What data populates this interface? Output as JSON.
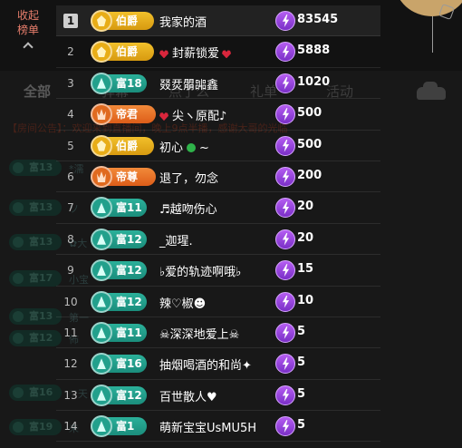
{
  "header": {
    "collapse_label_line1": "收起",
    "collapse_label_line2": "榜单"
  },
  "background": {
    "tabs": [
      "全部",
      "弹幕",
      "点了么",
      "礼单",
      "活动"
    ],
    "notice": "【房间公告】：欢迎来到直播间，晚上9点半播，感谢大哥的光临",
    "chat_badges": [
      "富13",
      "富13",
      "富13",
      "富17",
      "富13",
      "富12",
      "富16",
      "富19"
    ],
    "chat_snippets": [
      "*濡",
      "ソ",
      "✿大",
      "小宝",
      "第一",
      "佈",
      "♡天",
      "未"
    ]
  },
  "colors": {
    "gold_badge": "#f2c02b",
    "orange_badge": "#f28a3a",
    "teal_badge": "#2bb09a",
    "lightning": "#8a3ad6",
    "collapse_text": "#e87e6c"
  },
  "ranking": [
    {
      "rank": "1",
      "badge_type": "gold",
      "badge": "伯爵",
      "name": "我家的酒",
      "score": "83545"
    },
    {
      "rank": "2",
      "badge_type": "gold",
      "badge": "伯爵",
      "name": "封薪锁爱",
      "score": "5888",
      "hearts": true
    },
    {
      "rank": "3",
      "badge_type": "teal",
      "badge": "富18",
      "name": "叕烎朤嘂鑫",
      "score": "1020"
    },
    {
      "rank": "4",
      "badge_type": "orange",
      "badge": "帝君",
      "name": "尖ヽ原配♪",
      "score": "500",
      "heart_left": true
    },
    {
      "rank": "5",
      "badge_type": "gold",
      "badge": "伯爵",
      "name": "初心",
      "score": "500",
      "clover": true,
      "suffix": "~"
    },
    {
      "rank": "6",
      "badge_type": "orange",
      "badge": "帝尊",
      "name": "退了，勿念",
      "score": "200"
    },
    {
      "rank": "7",
      "badge_type": "teal",
      "badge": "富11",
      "name": "♬越吻伤心",
      "score": "20"
    },
    {
      "rank": "8",
      "badge_type": "teal",
      "badge": "富12",
      "name": "_迦瑆.",
      "score": "20"
    },
    {
      "rank": "9",
      "badge_type": "teal",
      "badge": "富12",
      "name": "♭爱的轨迹啊哦♭",
      "score": "15"
    },
    {
      "rank": "10",
      "badge_type": "teal",
      "badge": "富12",
      "name": "辣♡椒☻",
      "score": "10"
    },
    {
      "rank": "11",
      "badge_type": "teal",
      "badge": "富11",
      "name": "☠深深地爱上☠",
      "score": "5"
    },
    {
      "rank": "12",
      "badge_type": "teal",
      "badge": "富16",
      "name": "抽烟喝酒的和尚✦",
      "score": "5"
    },
    {
      "rank": "13",
      "badge_type": "teal",
      "badge": "富12",
      "name": "百世散人♥",
      "score": "5"
    },
    {
      "rank": "14",
      "badge_type": "teal",
      "badge": "富1",
      "name": "萌新宝宝UsMU5H",
      "score": "5"
    }
  ]
}
